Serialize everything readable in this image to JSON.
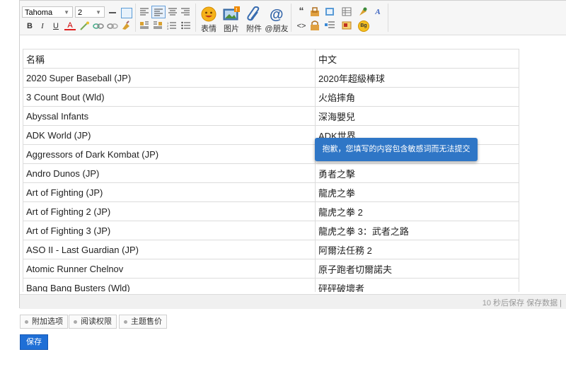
{
  "toolbar": {
    "font_family": "Tahoma",
    "font_size": "2",
    "buttons": {
      "bold": "B",
      "italic": "I",
      "underline": "U",
      "font_color": "A",
      "quote": "“",
      "code": "<>"
    },
    "big_buttons": [
      {
        "label": "表情",
        "icon": "smiley-icon"
      },
      {
        "label": "图片",
        "icon": "image-icon"
      },
      {
        "label": "附件",
        "icon": "paperclip-icon"
      },
      {
        "label": "@朋友",
        "icon": "at-icon"
      }
    ],
    "badge_text": "Bg"
  },
  "table": {
    "header": [
      "名稱",
      "中文"
    ],
    "rows": [
      [
        "2020 Super Baseball (JP)",
        "2020年超級棒球"
      ],
      [
        "3 Count Bout (Wld)",
        "火焰摔角"
      ],
      [
        "Abyssal Infants",
        "深海嬰兒"
      ],
      [
        "ADK World (JP)",
        "ADK世界"
      ],
      [
        "Aggressors of Dark Kombat (JP)",
        ""
      ],
      [
        "Andro Dunos (JP)",
        "勇者之擊"
      ],
      [
        "Art of Fighting (JP)",
        "龍虎之拳"
      ],
      [
        "Art of Fighting 2 (JP)",
        "龍虎之拳 2"
      ],
      [
        "Art of Fighting 3 (JP)",
        "龍虎之拳 3：武者之路"
      ],
      [
        "ASO II - Last Guardian (JP)",
        "阿爾法任務 2"
      ],
      [
        "Atomic Runner Chelnov",
        "原子跑者切爾諾夫"
      ],
      [
        "Bang Bang Busters (Wld)",
        "砰砰破壞者"
      ]
    ]
  },
  "tooltip": "抱歉，您填写的内容包含敏感词而无法提交",
  "status": "10 秒后保存 保存数据 |",
  "options": [
    "附加选项",
    "阅读权限",
    "主题售价"
  ],
  "save_label": "保存",
  "colors": {
    "accent": "#1f6fd6",
    "tooltip": "#2f76c6"
  }
}
